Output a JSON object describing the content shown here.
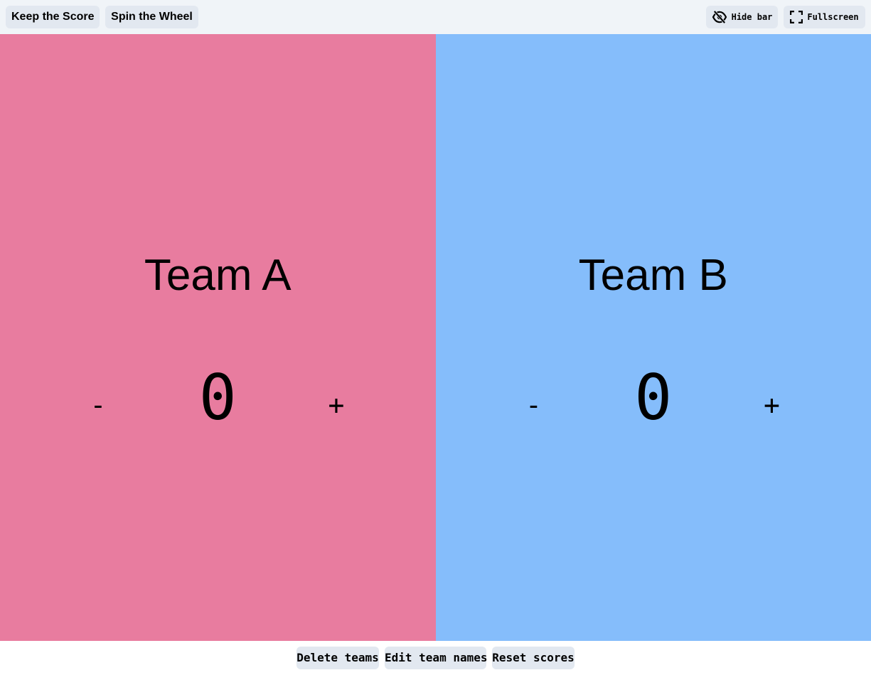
{
  "nav": {
    "keep_score": "Keep the Score",
    "spin_wheel": "Spin the Wheel"
  },
  "toolbar": {
    "hide_bar_label": "Hide bar",
    "hide_bar_icon": "eye-slash-icon",
    "fullscreen_label": "Fullscreen",
    "fullscreen_icon": "fullscreen-icon"
  },
  "teams": [
    {
      "name": "Team A",
      "score": "0",
      "minus_label": "-",
      "plus_label": "+",
      "color": "#e87c9f"
    },
    {
      "name": "Team B",
      "score": "0",
      "minus_label": "-",
      "plus_label": "+",
      "color": "#85bdfb"
    }
  ],
  "footer": {
    "delete_teams": "Delete teams",
    "edit_team_names": "Edit team names",
    "reset_scores": "Reset scores"
  },
  "colors": {
    "topbar_bg": "#f0f4f8",
    "button_bg": "#e2e8f0"
  }
}
